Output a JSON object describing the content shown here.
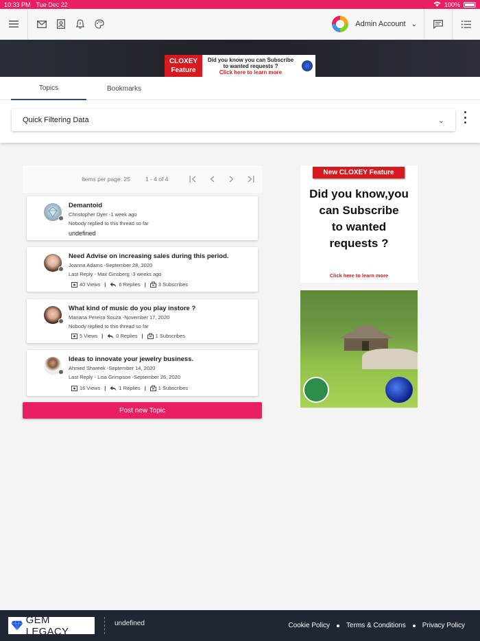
{
  "status_bar": {
    "time": "10:33 PM",
    "date": "Tue Dec 22",
    "battery": "100%"
  },
  "header": {
    "account_label": "Admin Account"
  },
  "banner": {
    "brand": "CLOXEY",
    "feature": "Feature",
    "line1": "Did you know you can Subscribe",
    "line2": "to wanted requests ?",
    "cta": "Click here to learn more"
  },
  "tabs": [
    {
      "label": "Topics"
    },
    {
      "label": "Bookmarks"
    }
  ],
  "filter": {
    "label": "Quick Filtering Data"
  },
  "paginator": {
    "items_per_page": "Items per page: 25",
    "range": "1 - 4 of 4"
  },
  "topics": [
    {
      "title": "Demantoid",
      "author_line": "Christopher Dyer -1 week ago",
      "reply_line": "Nobody replied to this thread so far",
      "extra": "undefined"
    },
    {
      "title": "Need Advise on increasing sales during this period.",
      "author_line": "Joanna Adams -September 28, 2020",
      "reply_line": "Last Reply - Max Ginsberg -3 weeks ago",
      "views": "40 Views",
      "replies": "6 Replies",
      "subscribes": "3 Subscribes"
    },
    {
      "title": "What kind of music do you play instore ?",
      "author_line": "Mariana Pereira Souza -November 17, 2020",
      "reply_line": "Nobody replied to this thread so far",
      "views": "5 Views",
      "replies": "0 Replies",
      "subscribes": "1 Subscribes"
    },
    {
      "title": "Ideas to innovate your jewelry business.",
      "author_line": "Ahmed Shareek -September 14, 2020",
      "reply_line": "Last Reply - Lisa Grimpson -September 26, 2020",
      "views": "16 Views",
      "replies": "1 Replies",
      "subscribes": "1 Subscribes"
    }
  ],
  "post_button": "Post new Topic",
  "side_ad": {
    "tag": "New CLOXEY Feature",
    "line1": "Did you know,you",
    "line2": "can Subscribe",
    "line3": "to wanted",
    "line4": "requests ?",
    "cta": "Click here to learn more"
  },
  "footer": {
    "logo_text": "GEM LEGACY",
    "extra": "undefined",
    "links": [
      "Cookie Policy",
      "Terms & Conditions",
      "Privacy Policy"
    ]
  },
  "colors": {
    "accent": "#e91e63",
    "footer_bg": "#202633",
    "ad_red": "#d71920"
  }
}
